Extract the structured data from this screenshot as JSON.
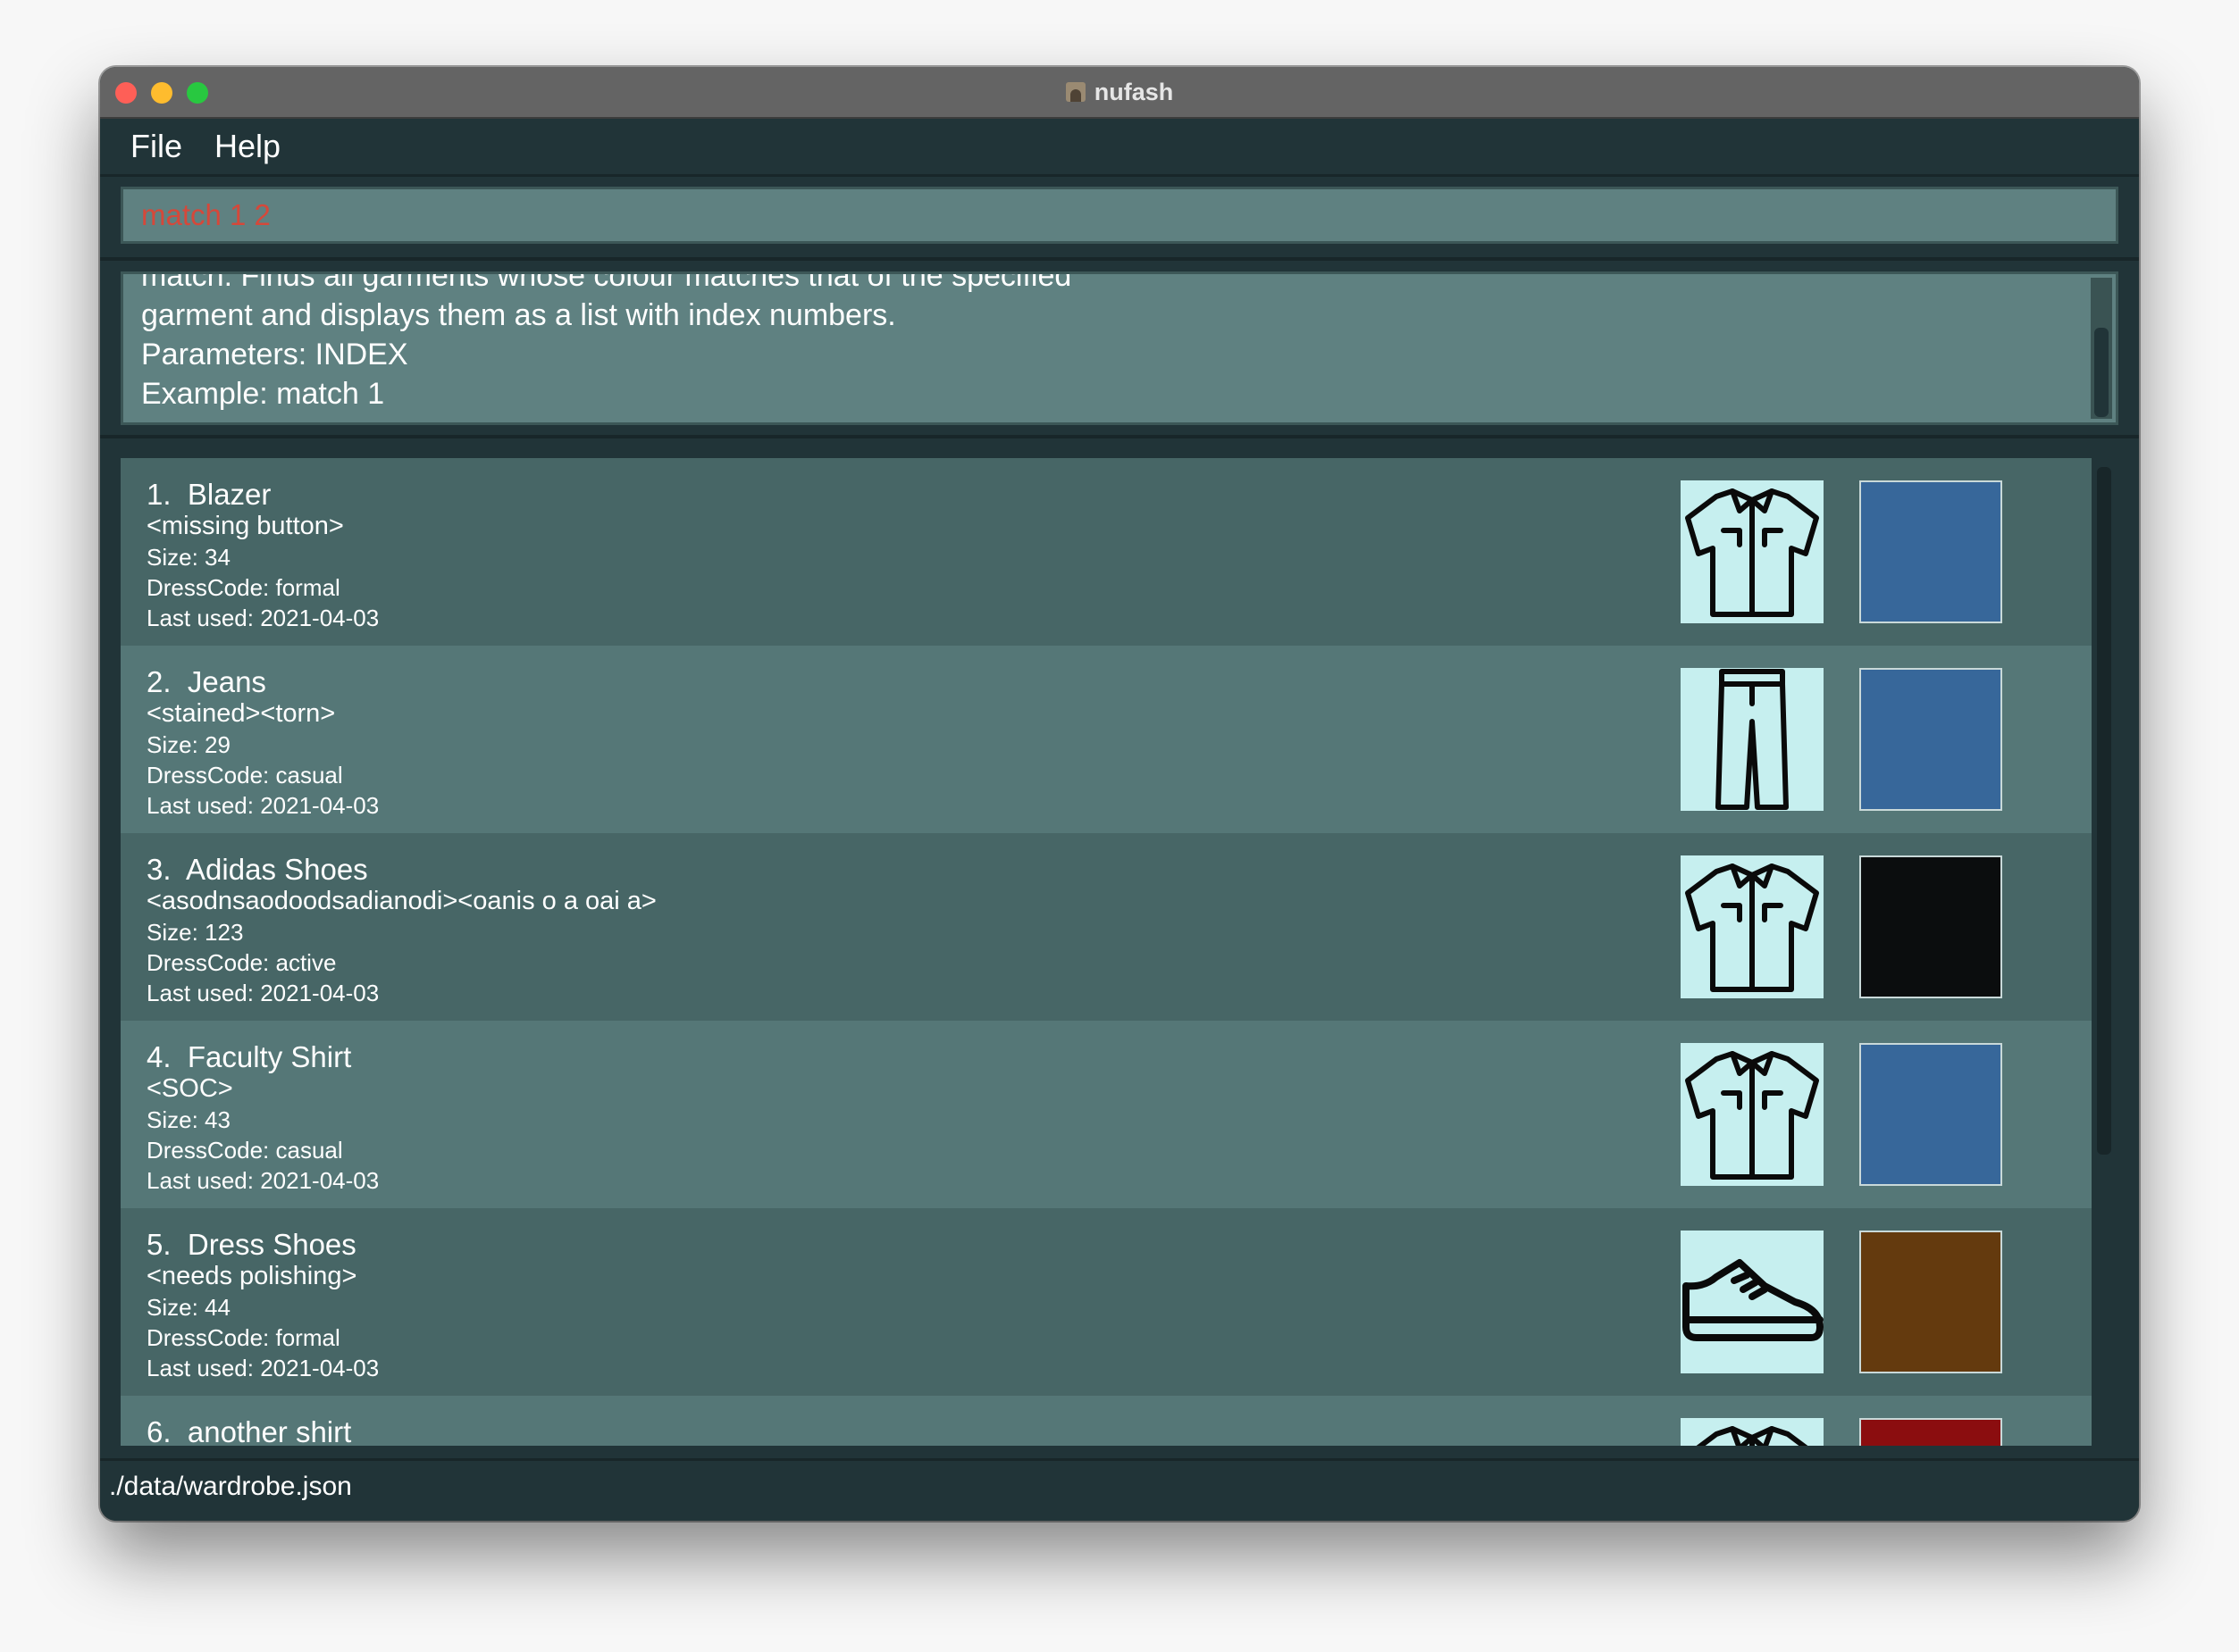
{
  "window": {
    "title": "nufash"
  },
  "menu": {
    "file": "File",
    "help": "Help"
  },
  "command": {
    "value": "match 1 2"
  },
  "result": {
    "lines": [
      "match: Finds all garments whose colour matches that of the specified",
      "garment and displays them as a list with index numbers.",
      "Parameters: INDEX",
      "Example: match 1"
    ]
  },
  "garments": [
    {
      "index": "1.",
      "name": "Blazer",
      "tags": "<missing button>",
      "size": "Size: 34",
      "dresscode": "DressCode: formal",
      "last_used": "Last used: 2021-04-03",
      "type_icon": "shirt-icon",
      "colour": "#37679a"
    },
    {
      "index": "2.",
      "name": "Jeans",
      "tags": "<stained><torn>",
      "size": "Size: 29",
      "dresscode": "DressCode: casual",
      "last_used": "Last used: 2021-04-03",
      "type_icon": "pants-icon",
      "colour": "#37679a"
    },
    {
      "index": "3.",
      "name": "Adidas Shoes",
      "tags": "<asodnsaodoodsadianodi><oanis o a oai a>",
      "size": "Size: 123",
      "dresscode": "DressCode: active",
      "last_used": "Last used: 2021-04-03",
      "type_icon": "shirt-icon",
      "colour": "#0b0d0e"
    },
    {
      "index": "4.",
      "name": "Faculty Shirt",
      "tags": "<SOC>",
      "size": "Size: 43",
      "dresscode": "DressCode: casual",
      "last_used": "Last used: 2021-04-03",
      "type_icon": "shirt-icon",
      "colour": "#37679a"
    },
    {
      "index": "5.",
      "name": "Dress Shoes",
      "tags": "<needs polishing>",
      "size": "Size: 44",
      "dresscode": "DressCode: formal",
      "last_used": "Last used: 2021-04-03",
      "type_icon": "shoe-icon",
      "colour": "#643a0e"
    },
    {
      "index": "6.",
      "name": "another shirt",
      "tags": "",
      "size": "",
      "dresscode": "",
      "last_used": "",
      "type_icon": "shirt-icon",
      "colour": "#8b0d0f"
    }
  ],
  "status": {
    "path": "./data/wardrobe.json"
  }
}
